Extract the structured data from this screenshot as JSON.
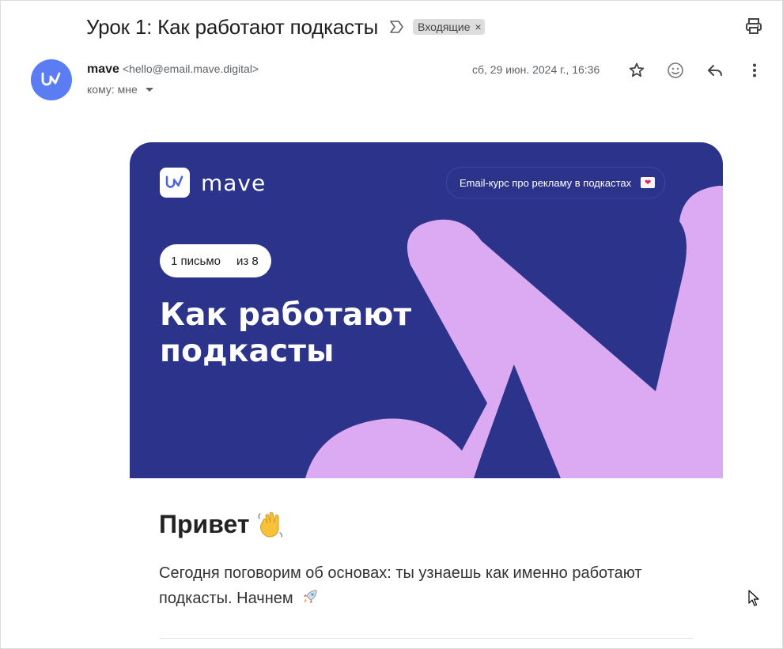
{
  "header": {
    "subject": "Урок 1: Как работают подкасты",
    "label": "Входящие",
    "label_close": "×"
  },
  "sender": {
    "name": "mave",
    "email": "<hello@email.mave.digital>",
    "to": "кому: мне",
    "date": "сб, 29 июн. 2024 г., 16:36"
  },
  "banner": {
    "logo_text": "mave",
    "course_label": "Email-курс про рекламу в подкастах",
    "letter_number": "1 письмо",
    "letter_total": "из 8",
    "title": "Как работают подкасты",
    "colors": {
      "background": "#2c338a",
      "shape": "#dcaaf2"
    }
  },
  "body": {
    "greeting": "Привет",
    "intro": "Сегодня поговорим об основах: ты узнаешь как именно работают подкасты. Начнем"
  },
  "icons": {
    "importance": "importance-marker-icon",
    "print": "print-icon",
    "star": "star-icon",
    "emoji": "emoji-reaction-icon",
    "reply": "reply-icon",
    "more": "more-vertical-icon",
    "wave": "waving-hand-icon",
    "rocket": "rocket-icon",
    "heart": "heart-icon",
    "cursor": "cursor-icon"
  },
  "colors": {
    "avatar": "#5b7df3"
  }
}
